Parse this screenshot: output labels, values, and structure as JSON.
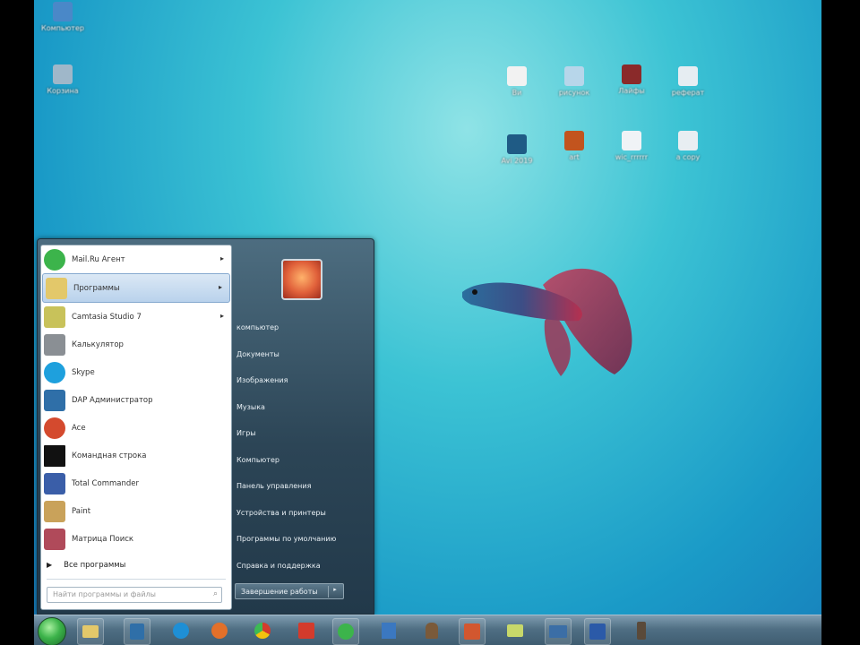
{
  "desktop": {
    "icons": [
      {
        "name": "computer",
        "label": "Компьютер",
        "color": "#4a88c8"
      },
      {
        "name": "recycle-bin",
        "label": "Корзина",
        "color": "#9fb7c9"
      },
      {
        "name": "file-1",
        "label": "Ви",
        "color": "#f2f2f2"
      },
      {
        "name": "file-2",
        "label": "рисунок",
        "color": "#b7d6ea"
      },
      {
        "name": "file-3",
        "label": "Лайфы",
        "color": "#8a2a2a"
      },
      {
        "name": "file-4",
        "label": "реферат",
        "color": "#e6edf2"
      },
      {
        "name": "file-5",
        "label": "Avi 2019",
        "color": "#1f5b85"
      },
      {
        "name": "file-6",
        "label": "art",
        "color": "#c2541e"
      },
      {
        "name": "file-7",
        "label": "wic_rrrrrr",
        "color": "#f0f3f6"
      },
      {
        "name": "file-8",
        "label": "a copy",
        "color": "#e8eef2"
      }
    ]
  },
  "start_menu": {
    "programs": [
      {
        "label": "Mail.Ru Агент",
        "icon": "mail-agent",
        "color": "#3cb44b",
        "submenu": true
      },
      {
        "label": "Программы",
        "icon": "folder",
        "color": "#e3c86a",
        "submenu": true,
        "active": true
      },
      {
        "label": "Camtasia Studio 7",
        "icon": "camtasia",
        "color": "#c8c25a",
        "submenu": true
      },
      {
        "label": "Калькулятор",
        "icon": "calculator",
        "color": "#8a8f94",
        "submenu": false
      },
      {
        "label": "Skype",
        "icon": "skype",
        "color": "#1ea0dd",
        "submenu": false
      },
      {
        "label": "DAP Администратор",
        "icon": "dap",
        "color": "#2f6fa8",
        "submenu": false
      },
      {
        "label": "Ace",
        "icon": "ace",
        "color": "#d44a2e",
        "submenu": false
      },
      {
        "label": "Командная строка",
        "icon": "cmd",
        "color": "#111111",
        "submenu": false
      },
      {
        "label": "Total Commander",
        "icon": "total-commander",
        "color": "#3a5ea8",
        "submenu": false
      },
      {
        "label": "Paint",
        "icon": "paint",
        "color": "#c9a25a",
        "submenu": false
      },
      {
        "label": "Матрица Поиск",
        "icon": "search-tool",
        "color": "#b04a5a",
        "submenu": false
      }
    ],
    "all_programs": "Все программы",
    "search_placeholder": "Найти программы и файлы",
    "right_items": [
      "компьютер",
      "Документы",
      "Изображения",
      "Музыка",
      "Игры",
      "Компьютер",
      "Панель управления",
      "Устройства и принтеры",
      "Программы по умолчанию",
      "Справка и поддержка"
    ],
    "shutdown_label": "Завершение работы"
  },
  "taskbar": {
    "items": [
      {
        "name": "windows-explorer",
        "color": "#e3c86a"
      },
      {
        "name": "media-player",
        "color": "#2f6fa8"
      },
      {
        "name": "internet-explorer",
        "color": "#1e8fd6"
      },
      {
        "name": "firefox",
        "color": "#e2702a"
      },
      {
        "name": "chrome",
        "color": "#d33b2c"
      },
      {
        "name": "mail-ru",
        "color": "#d33b2c"
      },
      {
        "name": "mail-agent",
        "color": "#3cb44b"
      },
      {
        "name": "paint-app",
        "color": "#3b78c0"
      },
      {
        "name": "user-tool",
        "color": "#7a5a3a"
      },
      {
        "name": "powerpoint",
        "color": "#d2572f"
      },
      {
        "name": "folder-app",
        "color": "#c7d86a"
      },
      {
        "name": "monitor-app",
        "color": "#3b6ea6"
      },
      {
        "name": "word",
        "color": "#2b5aa8"
      },
      {
        "name": "tool-app",
        "color": "#5a4a3a"
      }
    ]
  }
}
